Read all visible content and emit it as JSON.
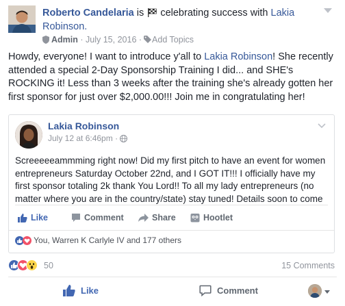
{
  "post": {
    "author": "Roberto Candelaria",
    "is_word": "is",
    "activity": "celebrating success with",
    "tagged": "Lakia Robinson.",
    "meta": {
      "role": "Admin",
      "date": "July 15, 2016",
      "separator": "·",
      "add_topics": "Add Topics"
    },
    "body": {
      "part1": "Howdy, everyone! I want to introduce y'all to ",
      "mention": "Lakia Robinson",
      "part2": "! She recently attended a special 2-Day Sponsorship Training I did... and SHE's ROCKING it! Less than 3 weeks after the training she's already gotten her first sponsor for just over $2,000.00!!! Join me in congratulating her!"
    }
  },
  "shared": {
    "author": "Lakia Robinson",
    "date": "July 12 at 6:46pm",
    "separator": "·",
    "text": "Screeeeeammming right now! Did my first pitch to have an event for women entrepreneurs Saturday October 22nd, and I GOT IT!!! I officially have my first sponsor totaling 2k thank You Lord!! To all my lady entrepreneurs (no matter where you are in the country/state) stay tuned! Details soon to come",
    "actions": {
      "like": "Like",
      "comment": "Comment",
      "share": "Share",
      "hootlet": "Hootlet"
    },
    "reactions_text": "You, Warren K Carlyle IV and 177 others"
  },
  "footer": {
    "reaction_count": "50",
    "comments_count": "15 Comments",
    "actions": {
      "like": "Like",
      "comment": "Comment"
    }
  },
  "colors": {
    "link": "#365899",
    "like_blue": "#4267b2",
    "muted": "#90949c",
    "love_red": "#f25268",
    "wow_yellow": "#fcd54c"
  }
}
